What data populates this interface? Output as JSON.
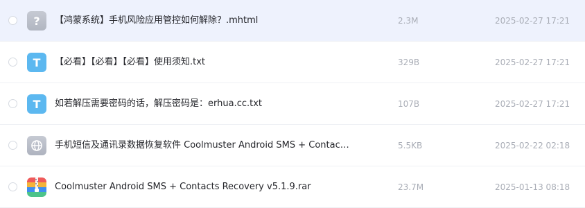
{
  "files": [
    {
      "name": "【鸿蒙系统】手机风险应用管控如何解除？.mhtml",
      "size": "2.3M",
      "date": "2025-02-27 17:21",
      "icon": "unknown-file-icon",
      "icon_glyph": "?",
      "highlighted": true
    },
    {
      "name": "【必看】【必看】【必看】使用须知.txt",
      "size": "329B",
      "date": "2025-02-27 17:21",
      "icon": "text-file-icon",
      "icon_glyph": "T",
      "highlighted": false
    },
    {
      "name": "如若解压需要密码的话，解压密码是：erhua.cc.txt",
      "size": "107B",
      "date": "2025-02-27 17:21",
      "icon": "text-file-icon",
      "icon_glyph": "T",
      "highlighted": false
    },
    {
      "name": "手机短信及通讯录数据恢复软件 Coolmuster Android SMS + Contac…",
      "size": "5.5KB",
      "date": "2025-02-22 02:18",
      "icon": "web-link-icon",
      "highlighted": false
    },
    {
      "name": "Coolmuster Android SMS + Contacts Recovery v5.1.9.rar",
      "size": "23.7M",
      "date": "2025-01-13 08:18",
      "icon": "archive-file-icon",
      "highlighted": false
    }
  ],
  "colors": {
    "highlight_row": "#eef2fd",
    "text_primary": "#25262b",
    "text_secondary": "#a9adb6",
    "text_icon": "#5cb8f0",
    "unknown_icon": "#b8bcc6"
  }
}
